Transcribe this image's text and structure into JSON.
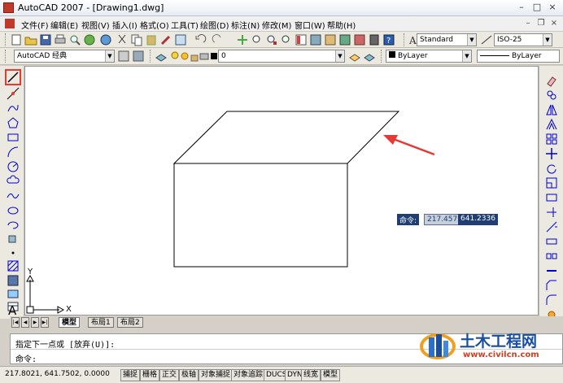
{
  "window": {
    "title": "AutoCAD 2007 - [Drawing1.dwg]",
    "minimize": "–",
    "maximize": "□",
    "close": "×"
  },
  "menubar": {
    "items": [
      "文件(F)",
      "编辑(E)",
      "视图(V)",
      "插入(I)",
      "格式(O)",
      "工具(T)",
      "绘图(D)",
      "标注(N)",
      "修改(M)",
      "窗口(W)",
      "帮助(H)"
    ]
  },
  "mdi": {
    "minimize": "–",
    "restore": "❐",
    "close": "×"
  },
  "styles_toolbar": {
    "text_style": "Standard",
    "dim_style": "ISO-25"
  },
  "layers_toolbar": {
    "workspace": "AutoCAD 经典",
    "layer": "0"
  },
  "properties_toolbar": {
    "color": "ByLayer",
    "linetype": "ByLayer",
    "lineweight": "ByLayer"
  },
  "dynamic_input": {
    "label": "命令:",
    "x_value": "217.4573",
    "y_value": "641.2336"
  },
  "ucs": {
    "x": "X",
    "y": "Y"
  },
  "layout_tabs": [
    "模型",
    "布局1",
    "布局2"
  ],
  "command_line": {
    "history": "指定下一点或 [放弃(U)]:",
    "prompt": "命令:"
  },
  "status": {
    "coords": "217.8021, 641.7502, 0.0000",
    "buttons": [
      "捕捉",
      "栅格",
      "正交",
      "极轴",
      "对象捕捉",
      "对象追踪",
      "DUCS",
      "DYN",
      "线宽",
      "模型"
    ]
  },
  "watermark": {
    "brand": "土木工程网",
    "url": "www.civilcn.com"
  },
  "colors": {
    "annotation": "#e53935",
    "dyn_label_bg": "#1f3f74",
    "dyn_value_bg": "#c7cfdc"
  }
}
